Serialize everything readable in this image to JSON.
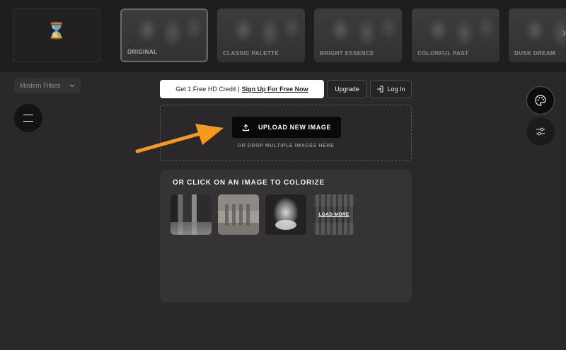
{
  "filters": [
    {
      "label": "",
      "state": "none"
    },
    {
      "label": "ORIGINAL",
      "state": "active"
    },
    {
      "label": "CLASSIC PALETTE",
      "state": "normal"
    },
    {
      "label": "BRIGHT ESSENCE",
      "state": "normal"
    },
    {
      "label": "COLORFUL PAST",
      "state": "normal"
    },
    {
      "label": "DUSK DREAM",
      "state": "normal"
    }
  ],
  "filter_select": {
    "value": "Modern Filters"
  },
  "header": {
    "credit_text": "Get 1 Free HD Credit",
    "separator": "|",
    "signup_link": "Sign Up For Free Now",
    "upgrade": "Upgrade",
    "login": "Log In"
  },
  "dropzone": {
    "upload_label": "UPLOAD NEW IMAGE",
    "hint": "OR DROP MULTIPLE IMAGES HERE"
  },
  "samples": {
    "title": "OR CLICK ON AN IMAGE TO COLORIZE",
    "load_more": "LOAD MORE"
  },
  "colors": {
    "background": "#2a2828",
    "annotation_arrow": "#f7991c",
    "panel": "#353333"
  }
}
